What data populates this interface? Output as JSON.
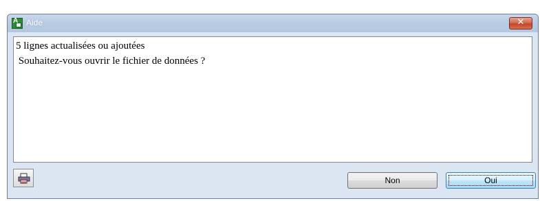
{
  "window": {
    "title": "Aide",
    "close_glyph": "✕"
  },
  "message": {
    "line1": "5 lignes actualisées ou ajoutées",
    "line2": " Souhaitez-vous ouvrir le fichier de données ?"
  },
  "buttons": {
    "no_label": "Non",
    "yes_label": "Oui"
  },
  "icons": {
    "app": "app-grid-icon",
    "print": "printer-icon",
    "close": "close-icon"
  },
  "colors": {
    "titlebar": "#b9cce3",
    "close": "#c3452a",
    "default_button_border": "#3c7fb1"
  }
}
